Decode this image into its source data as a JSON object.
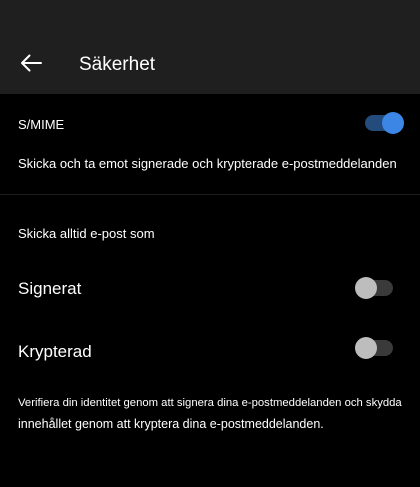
{
  "header": {
    "title": "Säkerhet",
    "back_icon": "arrow-left-icon"
  },
  "smime": {
    "label": "S/MIME",
    "enabled": true,
    "description": "Skicka och ta emot signerade och krypterade e-postmeddelanden"
  },
  "section": {
    "heading": "Skicka alltid e-post som"
  },
  "options": [
    {
      "label": "Signerat",
      "enabled": false
    },
    {
      "label": "Krypterad",
      "enabled": false
    }
  ],
  "footer": {
    "line1": "Verifiera din identitet genom att signera dina e-postmeddelanden och skydda",
    "line2": "innehållet genom att kryptera dina e-postmeddelanden."
  },
  "colors": {
    "background": "#000000",
    "header_background": "#1f1f1f",
    "toggle_on_knob": "#3c86e6",
    "toggle_on_track": "#234c7d",
    "toggle_off_knob": "#bdbdbd",
    "toggle_off_track": "#3a3a3a"
  }
}
